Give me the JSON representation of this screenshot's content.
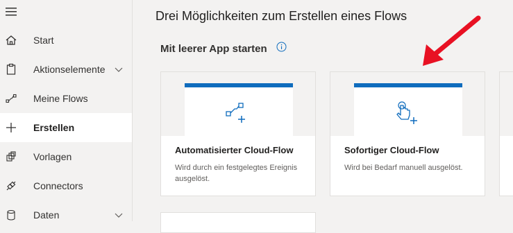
{
  "sidebar": {
    "items": [
      {
        "label": "Start",
        "icon": "home-icon"
      },
      {
        "label": "Aktionselemente",
        "icon": "clipboard-icon",
        "expandable": true
      },
      {
        "label": "Meine Flows",
        "icon": "flow-icon"
      },
      {
        "label": "Erstellen",
        "icon": "plus-icon",
        "active": true
      },
      {
        "label": "Vorlagen",
        "icon": "templates-icon"
      },
      {
        "label": "Connectors",
        "icon": "connector-icon"
      },
      {
        "label": "Daten",
        "icon": "data-icon",
        "expandable": true
      }
    ]
  },
  "main": {
    "title": "Drei Möglichkeiten zum Erstellen eines Flows",
    "section_title": "Mit leerer App starten",
    "cards": [
      {
        "title": "Automatisierter Cloud-Flow",
        "description": "Wird durch ein festgelegtes Ereignis ausgelöst.",
        "icon": "automated-flow-icon"
      },
      {
        "title": "Sofortiger Cloud-Flow",
        "description": "Wird bei Bedarf manuell ausgelöst.",
        "icon": "touch-icon"
      }
    ]
  },
  "colors": {
    "accent": "#0f6cbd",
    "annotation_arrow": "#e81123"
  }
}
